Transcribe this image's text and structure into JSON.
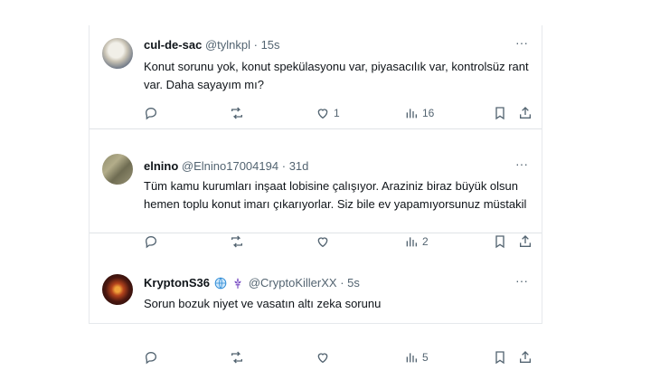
{
  "tweets": [
    {
      "name": "cul-de-sac",
      "handle": "@tylnkpl",
      "separator": "·",
      "time": "15s",
      "text": "Konut sorunu yok, konut spekülasyonu var, piyasacılık var, kontrolsüz rant var. Daha sayayım mı?",
      "stats": {
        "replies": "",
        "retweets": "",
        "likes": "1",
        "views": "16"
      }
    },
    {
      "name": "elnino",
      "handle": "@Elnino17004194",
      "separator": "·",
      "time": "31d",
      "text": "Tüm kamu kurumları inşaat lobisine çalışıyor. Araziniz biraz büyük olsun hemen toplu konut imarı çıkarıyorlar. Siz bile ev yapamıyorsunuz müstakil",
      "stats": {
        "replies": "",
        "retweets": "",
        "likes": "",
        "views": "2"
      }
    },
    {
      "name": "KryptonS36",
      "handle": "@CryptoKillerXX",
      "separator": "·",
      "time": "5s",
      "text": "Sorun bozuk niyet ve vasatın altı zeka sorunu",
      "stats": {
        "replies": "",
        "retweets": "",
        "likes": "",
        "views": "5"
      },
      "badges": [
        "globe-icon",
        "fleur-de-lis-icon"
      ]
    }
  ],
  "more_glyph": "···",
  "colors": {
    "text": "#0f1419",
    "secondary": "#536471",
    "border": "#dfe3e6"
  }
}
